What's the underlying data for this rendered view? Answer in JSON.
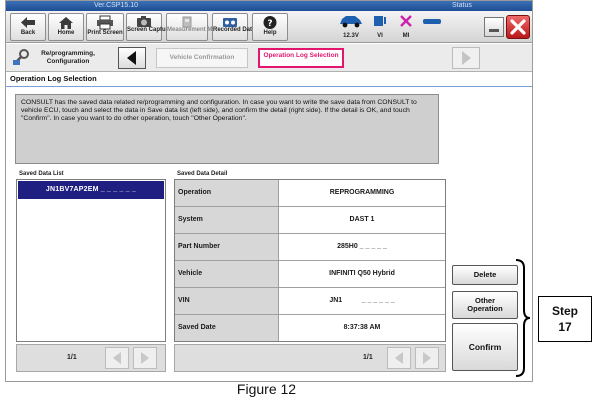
{
  "title_strip": {
    "version": "Ver.CSP15.10",
    "status": "Status"
  },
  "toolbar": {
    "buttons": [
      {
        "label": "Back",
        "icon": "left-arrow-icon"
      },
      {
        "label": "Home",
        "icon": "home-icon"
      },
      {
        "label": "Print Screen",
        "icon": "printer-icon"
      },
      {
        "label": "Screen Capture",
        "icon": "camera-icon"
      },
      {
        "label": "Measurement Mode",
        "icon": "meter-icon"
      },
      {
        "label": "Recorded Data",
        "icon": "recorder-icon"
      },
      {
        "label": "Help",
        "icon": "help-icon"
      }
    ],
    "status": {
      "battery": "12.3V",
      "vi": "VI",
      "mi": "MI"
    }
  },
  "breadcrumb": {
    "current": "Re/programming, Configuration",
    "steps": [
      "Vehicle Confirmation",
      "Operation Log Selection"
    ]
  },
  "section_title": "Operation Log Selection",
  "instructions": "CONSULT has the saved data related re/programming and configuration. In case you want to write the save data from CONSULT to vehicle ECU, touch and select the data in Save data list (left side), and confirm the detail (right side). If the detail is OK, and touch \"Confirm\". In case you want to do other operation, touch \"Other Operation\".",
  "saved_list": {
    "header": "Saved Data List",
    "items": [
      "JN1BV7AP2EM _ _ _ _ _ _"
    ],
    "pager": "1/1"
  },
  "saved_detail": {
    "header": "Saved Data Detail",
    "rows": [
      {
        "label": "Operation",
        "value": "REPROGRAMMING"
      },
      {
        "label": "System",
        "value": "DAST 1"
      },
      {
        "label": "Part Number",
        "value": "285H0 _ _ _ _ _"
      },
      {
        "label": "Vehicle",
        "value": "INFINITI Q50 Hybrid"
      },
      {
        "label": "VIN",
        "value": "JN1          _ _ _ _ _ _"
      },
      {
        "label": "Saved Date",
        "value": "8:37:38 AM"
      }
    ],
    "pager": "1/1"
  },
  "actions": {
    "delete": "Delete",
    "other_line1": "Other",
    "other_line2": "Operation",
    "confirm": "Confirm"
  },
  "callout": {
    "line1": "Step",
    "line2": "17"
  },
  "caption": "Figure 12",
  "colors": {
    "selection": "#1f1f82",
    "active_step": "#e2166e",
    "close_button": "#c0201f"
  }
}
